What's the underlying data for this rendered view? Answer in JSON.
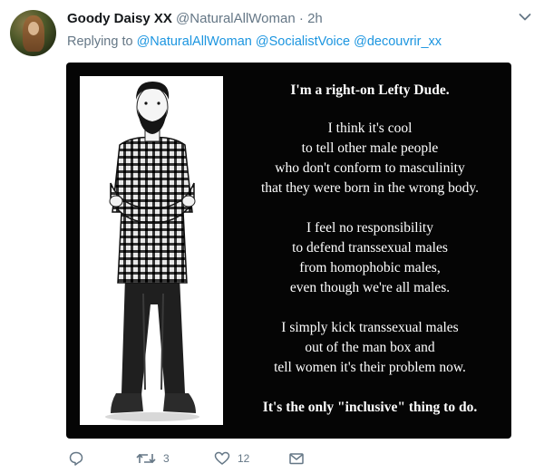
{
  "tweet": {
    "display_name": "Goody Daisy XX",
    "handle": "@NaturalAllWoman",
    "separator": "·",
    "time": "2h",
    "replying_prefix": "Replying to",
    "mentions": [
      "@NaturalAllWoman",
      "@SocialistVoice",
      "@decouvrir_xx"
    ]
  },
  "media": {
    "title": "I'm a right-on Lefty Dude.",
    "stanzas": [
      [
        "I think it's cool",
        "to tell other male people",
        "who don't conform to masculinity",
        "that they were born in the wrong body."
      ],
      [
        "I feel no responsibility",
        "to defend transsexual males",
        "from homophobic males,",
        "even though we're all males."
      ],
      [
        "I simply kick transsexual males",
        "out of the man box and",
        "tell women it's their problem now."
      ]
    ],
    "closing": "It's the only \"inclusive\" thing to do."
  },
  "actions": {
    "reply_icon": "reply-icon",
    "retweet_icon": "retweet-icon",
    "retweet_count": "3",
    "like_icon": "heart-icon",
    "like_count": "12",
    "dm_icon": "envelope-icon"
  },
  "colors": {
    "link": "#1b95e0",
    "muted": "#657786",
    "text": "#14171a",
    "media_bg": "#050505"
  }
}
